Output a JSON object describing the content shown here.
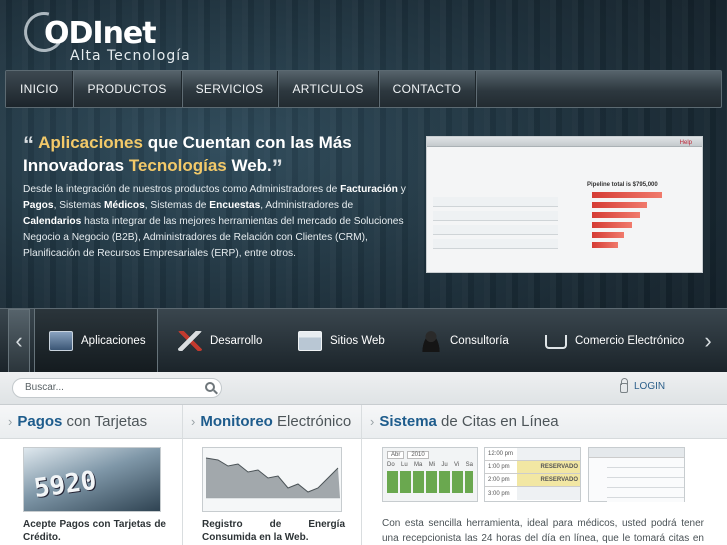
{
  "logo": {
    "name": "ODInet",
    "tagline": "Alta Tecnología"
  },
  "nav": {
    "items": [
      "INICIO",
      "PRODUCTOS",
      "SERVICIOS",
      "ARTICULOS",
      "CONTACTO"
    ],
    "active": 0
  },
  "hero": {
    "open_quote": "“",
    "close_quote": "”",
    "title_hl1": "Aplicaciones",
    "title_mid": " que Cuentan con las Más Innovadoras ",
    "title_hl2": "Tecnologías",
    "title_end": " Web.",
    "text_parts": [
      "Desde la integración de nuestros productos como Administradores de ",
      "Facturación",
      " y ",
      "Pagos",
      ", Sistemas ",
      "Médicos",
      ", Sistemas de ",
      "Encuestas",
      ", Administradores de ",
      "Calendarios",
      " hasta integrar de las mejores herramientas del mercado de Soluciones Negocio a Negocio (B2B), Administradores de Relación con Clientes (CRM), Planificación de Recursos Empresariales (ERP), entre otros."
    ]
  },
  "carousel": {
    "prev_icon": "chevron-left-icon",
    "next_icon": "chevron-right-icon",
    "items": [
      {
        "label": "Aplicaciones",
        "icon": "monitor-icon"
      },
      {
        "label": "Desarrollo",
        "icon": "tools-icon"
      },
      {
        "label": "Sitios Web",
        "icon": "website-icon"
      },
      {
        "label": "Consultoría",
        "icon": "person-icon"
      },
      {
        "label": "Comercio Electrónico",
        "icon": "cart-icon"
      }
    ]
  },
  "search": {
    "placeholder": "Buscar..."
  },
  "login": {
    "label": "LOGIN"
  },
  "columns": [
    {
      "hl": "Pagos",
      "rest": " con Tarjetas",
      "text": "Acepte Pagos con Tarjetas de Crédito."
    },
    {
      "hl": "Monitoreo",
      "rest": " Electrónico",
      "text": "Registro de Energía Consumida en la Web."
    },
    {
      "hl": "Sistema",
      "rest": " de Citas en Línea",
      "text": "Con esta sencilla herramienta, ideal para médicos, usted podrá tener una recepcionista las 24 horas del día en línea, que le tomará citas en horarios"
    }
  ],
  "thumb_texts": {
    "card_number": "5920",
    "cal_month": "Abr",
    "cal_year": "2010",
    "cal_days": [
      "Do",
      "Lu",
      "Ma",
      "Mi",
      "Ju",
      "Vi",
      "Sa"
    ],
    "slots": [
      "12:00 pm",
      "1:00 pm",
      "2:00 pm",
      "3:00 pm"
    ],
    "reserved": "RESERVADO",
    "hero_shot_link": "Help",
    "hero_shot_chart": "Pipeline total is $795,000"
  },
  "colors": {
    "accent": "#1e5c8c",
    "highlight": "#f3c969",
    "nav_bg": "#2d383f"
  }
}
